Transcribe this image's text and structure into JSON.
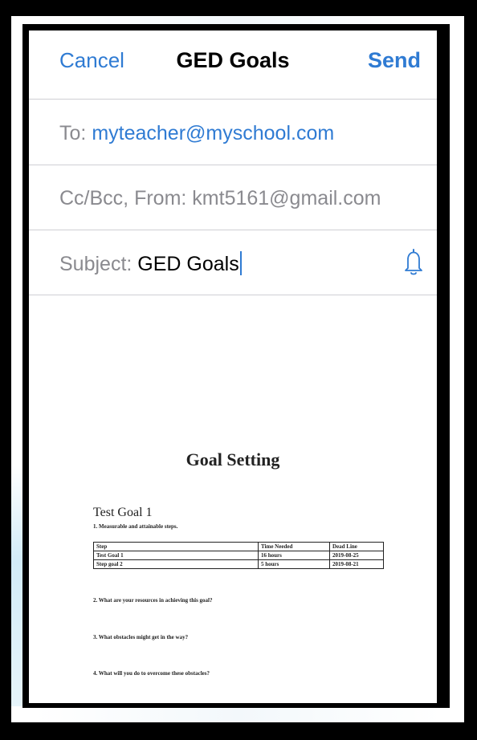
{
  "nav": {
    "cancel_label": "Cancel",
    "title": "GED Goals",
    "send_label": "Send"
  },
  "to": {
    "label": "To:",
    "value": "myteacher@myschool.com"
  },
  "ccbcc": {
    "label": "Cc/Bcc, From:",
    "value": "kmt5161@gmail.com"
  },
  "subject": {
    "label": "Subject:",
    "value": "GED Goals"
  },
  "icons": {
    "notify": "bell-icon"
  },
  "colors": {
    "accent": "#2f7bd3",
    "divider": "#cfcfd4"
  },
  "document": {
    "title": "Goal Setting",
    "goal": "Test Goal 1",
    "q1": "1. Measurable and attainable steps.",
    "table": {
      "headers": [
        "Step",
        "Time Needed",
        "Dead Line"
      ],
      "rows": [
        [
          "Test Goal 1",
          "16 hours",
          "2019-08-25"
        ],
        [
          "Step goal 2",
          "5 hours",
          "2019-08-21"
        ]
      ]
    },
    "q2": "2. What are your resources in achieving this goal?",
    "q3": "3. What obstacles might get in the way?",
    "q4": "4. What will you do to overcome these obstacles?"
  }
}
